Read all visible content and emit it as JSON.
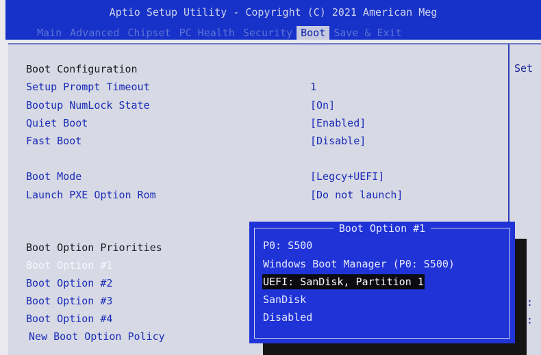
{
  "header": {
    "title": "Aptio Setup Utility - Copyright (C) 2021 American Meg",
    "menu": [
      {
        "label": "Main"
      },
      {
        "label": "Advanced"
      },
      {
        "label": "Chipset"
      },
      {
        "label": "PC Health"
      },
      {
        "label": "Security"
      },
      {
        "label": "Boot",
        "active": true
      },
      {
        "label": "Save & Exit"
      }
    ]
  },
  "settings": {
    "heading": "Boot Configuration",
    "items": [
      {
        "label": "Setup Prompt Timeout",
        "value": "1"
      },
      {
        "label": "Bootup NumLock State",
        "value": "[On]"
      },
      {
        "label": "Quiet Boot",
        "value": "[Enabled]"
      },
      {
        "label": "Fast Boot",
        "value": "[Disable]"
      },
      {
        "label": "Boot Mode",
        "value": "[Legcy+UEFI]"
      },
      {
        "label": "Launch PXE Option Rom",
        "value": "[Do not launch]"
      }
    ],
    "priorities_heading": "Boot Option Priorities",
    "priorities": [
      {
        "label": "Boot Option #1",
        "selected": true
      },
      {
        "label": "Boot Option #2"
      },
      {
        "label": "Boot Option #3"
      },
      {
        "label": "Boot Option #4"
      },
      {
        "label": "New Boot Option Policy"
      }
    ]
  },
  "help": {
    "text": "Set",
    "colon_a": ":",
    "colon_b": ":"
  },
  "popup": {
    "title": "Boot Option #1",
    "options": [
      {
        "label": "P0: S500"
      },
      {
        "label": "Windows Boot Manager (P0: S500)"
      },
      {
        "label": "UEFI: SanDisk, Partition 1",
        "highlighted": true
      },
      {
        "label": "SanDisk"
      },
      {
        "label": "Disabled"
      }
    ]
  },
  "colors": {
    "bios_blue": "#1f33d6",
    "panel_gray": "#d7d9e4",
    "text_blue": "#1a2cb8",
    "highlight_black": "#0a0a10"
  }
}
